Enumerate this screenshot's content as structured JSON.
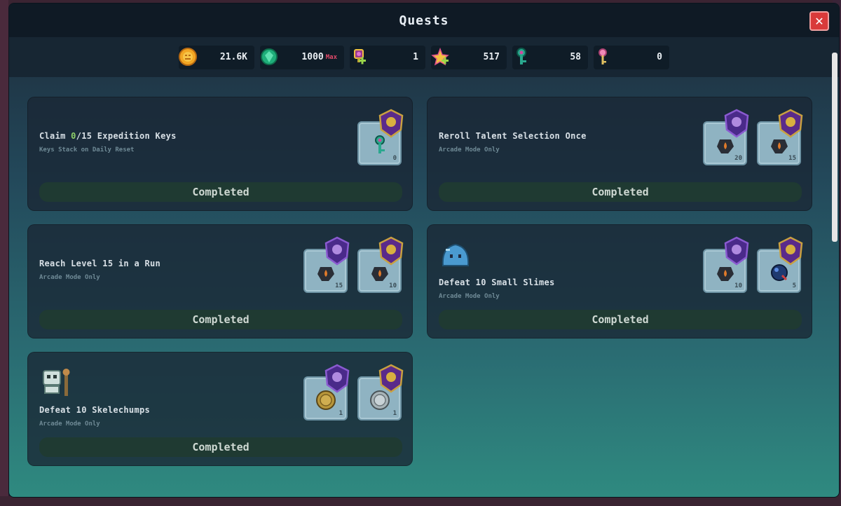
{
  "window": {
    "title": "Quests",
    "close_label": "✕"
  },
  "currencies": [
    {
      "icon": "gold-coin-icon",
      "value": "21.6K",
      "suffix": ""
    },
    {
      "icon": "green-gem-icon",
      "value": "1000",
      "suffix": "Max"
    },
    {
      "icon": "trophy-plus-icon",
      "value": "1",
      "suffix": ""
    },
    {
      "icon": "star-plus-icon",
      "value": "517",
      "suffix": ""
    },
    {
      "icon": "expedition-key-icon",
      "value": "58",
      "suffix": ""
    },
    {
      "icon": "pink-key-icon",
      "value": "0",
      "suffix": ""
    }
  ],
  "quests": [
    {
      "title_pre": "Claim ",
      "title_hl": "0",
      "title_post": "/15 Expedition Keys",
      "subtitle": "Keys Stack on Daily Reset",
      "status": "Completed",
      "rewards": [
        {
          "item": "expedition-key-icon",
          "badge": "gold-badge-icon",
          "count": "0"
        }
      ]
    },
    {
      "title_pre": "Reroll Talent Selection Once",
      "title_hl": "",
      "title_post": "",
      "subtitle": "Arcade Mode Only",
      "status": "Completed",
      "rewards": [
        {
          "item": "ember-stone-icon",
          "badge": "purple-badge-icon",
          "count": "20"
        },
        {
          "item": "ember-stone-icon",
          "badge": "gold-badge-icon",
          "count": "15"
        }
      ]
    },
    {
      "title_pre": "Reach Level 15 in a Run",
      "title_hl": "",
      "title_post": "",
      "subtitle": "Arcade Mode Only",
      "status": "Completed",
      "rewards": [
        {
          "item": "ember-stone-icon",
          "badge": "purple-badge-icon",
          "count": "15"
        },
        {
          "item": "ember-stone-icon",
          "badge": "gold-badge-icon",
          "count": "10"
        }
      ]
    },
    {
      "title_pre": "Defeat 10 Small Slimes",
      "title_hl": "",
      "title_post": "",
      "subtitle": "Arcade Mode Only",
      "status": "Completed",
      "rewards": [
        {
          "item": "ember-stone-icon",
          "badge": "purple-badge-icon",
          "count": "10"
        },
        {
          "item": "blue-orb-icon",
          "badge": "gold-badge-icon",
          "count": "5"
        }
      ]
    },
    {
      "title_pre": "Defeat 10 Skelechumps",
      "title_hl": "",
      "title_post": "",
      "subtitle": "Arcade Mode Only",
      "status": "Completed",
      "rewards": [
        {
          "item": "gold-coin-token-icon",
          "badge": "purple-badge-icon",
          "count": "1"
        },
        {
          "item": "silver-coin-token-icon",
          "badge": "gold-badge-icon",
          "count": "1"
        }
      ]
    }
  ]
}
